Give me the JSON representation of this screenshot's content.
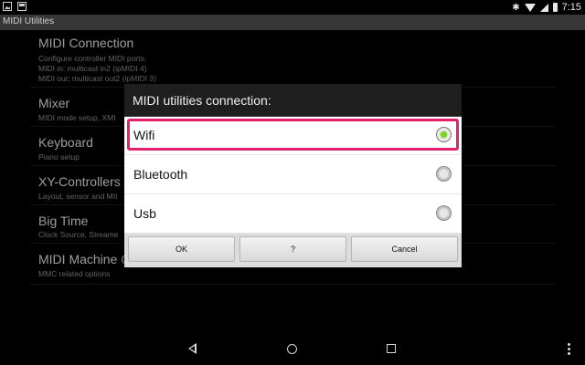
{
  "statusbar": {
    "time": "7:15",
    "icons": [
      "photo-icon",
      "message-icon",
      "bluetooth-icon",
      "wifi-icon",
      "signal-icon",
      "battery-icon"
    ]
  },
  "app": {
    "title": "MIDI Utilities"
  },
  "list": {
    "items": [
      {
        "title": "MIDI Connection",
        "subtitle": [
          "Configure controller MIDI ports:",
          "MIDI in: multicast in2 (ipMIDI 4)",
          "MIDI out: multicast out2 (ipMIDI 3)"
        ]
      },
      {
        "title": "Mixer",
        "subtitle": [
          "MIDI mode setup, XMI"
        ]
      },
      {
        "title": "Keyboard",
        "subtitle": [
          "Piano setup"
        ]
      },
      {
        "title": "XY-Controllers",
        "subtitle": [
          "Layout, sensor and MII"
        ]
      },
      {
        "title": "Big Time",
        "subtitle": [
          "Clock Source, Streame"
        ]
      },
      {
        "title": "MIDI Machine C",
        "subtitle": [
          "MMC related options"
        ]
      }
    ]
  },
  "dialog": {
    "title": "MIDI utilities connection:",
    "options": [
      {
        "label": "Wifi",
        "selected": true
      },
      {
        "label": "Bluetooth",
        "selected": false
      },
      {
        "label": "Usb",
        "selected": false
      }
    ],
    "buttons": {
      "ok": "OK",
      "help": "?",
      "cancel": "Cancel"
    }
  },
  "colors": {
    "highlight": "#e5206e",
    "radio_selected": "#7ed321"
  }
}
